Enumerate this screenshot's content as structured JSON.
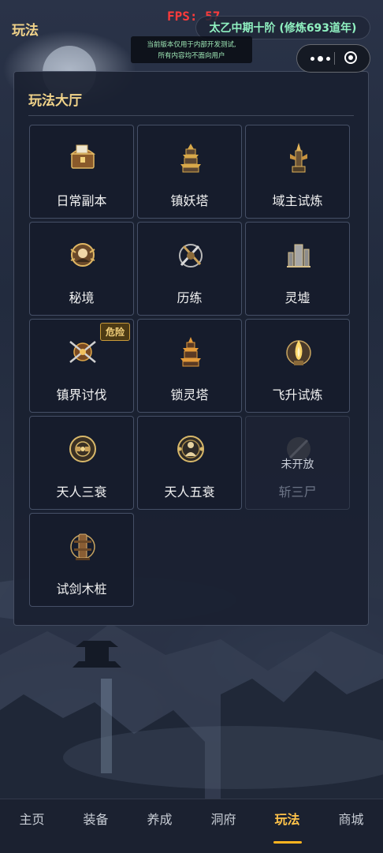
{
  "header": {
    "page_title": "玩法",
    "fps_text": "FPS: 57",
    "realm_text": "太乙中期十阶 (修炼693道年)",
    "notice_line1": "当前版本仅用于内部开发测试,",
    "notice_line2": "所有内容均不面向用户"
  },
  "panel": {
    "title": "玩法大厅",
    "cards": [
      {
        "label": "日常副本",
        "icon": "treasure-chest-icon"
      },
      {
        "label": "镇妖塔",
        "icon": "pagoda-icon"
      },
      {
        "label": "域主试炼",
        "icon": "spire-tower-icon"
      },
      {
        "label": "秘境",
        "icon": "mystic-realm-icon"
      },
      {
        "label": "历练",
        "icon": "training-weapons-icon"
      },
      {
        "label": "灵墟",
        "icon": "spirit-ruins-icon"
      },
      {
        "label": "镇界讨伐",
        "icon": "crossed-blades-icon",
        "badge": "危险"
      },
      {
        "label": "锁灵塔",
        "icon": "spirit-lock-tower-icon"
      },
      {
        "label": "飞升试炼",
        "icon": "ascension-flame-icon"
      },
      {
        "label": "天人三衰",
        "icon": "bagua-emblem-icon"
      },
      {
        "label": "天人五衰",
        "icon": "deity-emblem-icon"
      },
      {
        "label": "斩三尸",
        "icon": "sword-slash-icon",
        "locked_text": "未开放"
      },
      {
        "label": "试剑木桩",
        "icon": "wooden-dummy-icon"
      }
    ]
  },
  "bottom_nav": [
    {
      "label": "主页"
    },
    {
      "label": "装备"
    },
    {
      "label": "养成"
    },
    {
      "label": "洞府"
    },
    {
      "label": "玩法"
    },
    {
      "label": "商城"
    }
  ],
  "colors": {
    "accent_gold": "#f2d48a",
    "fps_red": "#ff3b3b",
    "realm_green": "#8ff0c0",
    "nav_active": "#ffc34a"
  }
}
